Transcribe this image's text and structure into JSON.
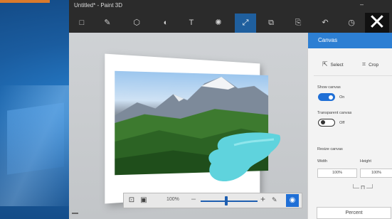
{
  "window": {
    "title": "Untitled* - Paint 3D",
    "minimize_label": "–"
  },
  "toolbar": {
    "tools": [
      {
        "name": "brushes",
        "icon": "□"
      },
      {
        "name": "brush",
        "icon": "✎"
      },
      {
        "name": "3d-shapes",
        "icon": "⬡"
      },
      {
        "name": "stickers",
        "icon": "◐"
      },
      {
        "name": "text",
        "icon": "T"
      },
      {
        "name": "effects",
        "icon": "✺"
      },
      {
        "name": "canvas",
        "icon": "⤢"
      },
      {
        "name": "remix-3d",
        "icon": "⧉"
      },
      {
        "name": "paste",
        "icon": "⎘"
      },
      {
        "name": "undo",
        "icon": "↶"
      },
      {
        "name": "history",
        "icon": "◷"
      }
    ],
    "active_tool": "canvas",
    "close_label": "✕"
  },
  "bottom_bar": {
    "zoom": "100%",
    "minus": "–",
    "plus": "+",
    "zoom_level": 0.5
  },
  "panel": {
    "title": "Canvas",
    "select_label": "Select",
    "crop_label": "Crop",
    "show_canvas_label": "Show canvas",
    "show_canvas_state": "On",
    "show_canvas_on": true,
    "transparent_canvas_label": "Transparent canvas",
    "transparent_canvas_state": "Off",
    "transparent_canvas_on": false,
    "resize_label": "Resize canvas",
    "width_label": "Width",
    "height_label": "Height",
    "width_value": "100%",
    "height_value": "100%",
    "percent_label": "Percent"
  },
  "colors": {
    "accent": "#2d7fd3",
    "toolbar_bg": "#2b2b2b",
    "splash": "#5fd3dd"
  }
}
